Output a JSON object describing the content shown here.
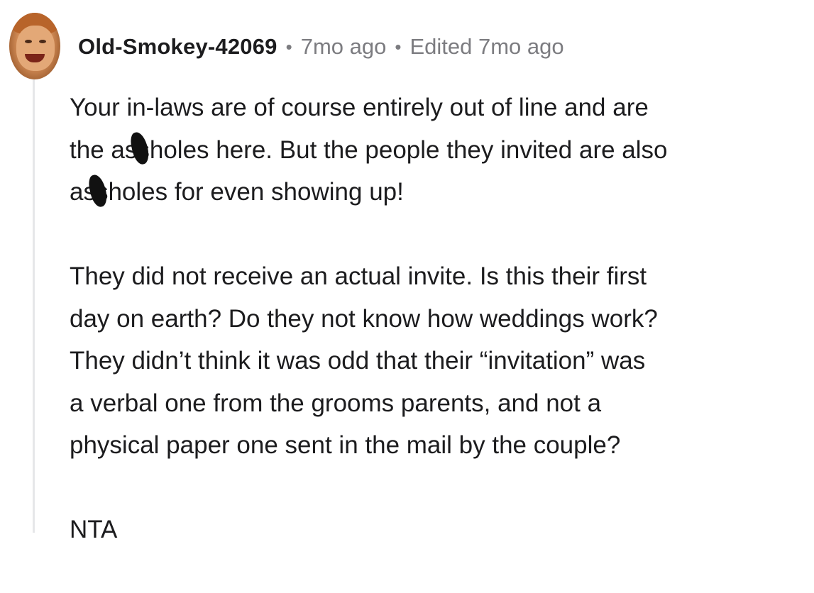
{
  "comment": {
    "username": "Old-Smokey-42069",
    "separator": "•",
    "time_ago": "7mo ago",
    "edited": "Edited 7mo ago",
    "paragraphs": [
      {
        "lines": [
          "Your in-laws are of course entirely out of line and are",
          [
            "the a",
            "ss",
            "holes here. But the people they invited are also"
          ],
          [
            "a",
            "ss",
            "holes for even showing up!"
          ]
        ]
      },
      {
        "lines": [
          "They did not receive an actual invite. Is this their first",
          "day on earth? Do they not know how weddings work?",
          "They didn’t think it was odd that their “invitation” was",
          "a verbal one from the grooms parents, and not a",
          "physical paper one sent in the mail by the couple?"
        ]
      },
      {
        "lines": [
          "NTA"
        ]
      }
    ]
  }
}
